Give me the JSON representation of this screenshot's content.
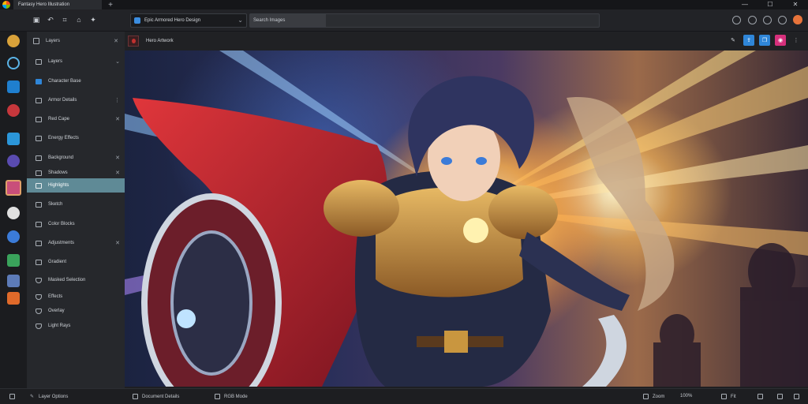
{
  "window": {
    "tab_title": "Fantasy Hero Illustration",
    "new_tab": "+",
    "minimize": "—",
    "maximize": "☐",
    "close": "✕"
  },
  "toolbar": {
    "address_value": "Epic Armored Hero Design",
    "search_label": "Search Images",
    "search_placeholder": ""
  },
  "sidebar": {
    "header": "Layers",
    "items": [
      {
        "label": "Layers"
      },
      {
        "label": "Character Base"
      },
      {
        "label": "Armor Details"
      },
      {
        "label": "Red Cape"
      },
      {
        "label": "Energy Effects"
      },
      {
        "label": "Background"
      },
      {
        "label": "Shadows"
      },
      {
        "label": "Highlights"
      },
      {
        "label": "Sketch"
      },
      {
        "label": "Color Blocks"
      },
      {
        "label": "Adjustments"
      },
      {
        "label": "Gradient"
      },
      {
        "label": "Masked Selection"
      },
      {
        "label": "Effects"
      },
      {
        "label": "Overlay"
      },
      {
        "label": "Light Rays"
      }
    ]
  },
  "doc_tab": {
    "label": "Hero Artwork"
  },
  "status": {
    "left_label": "Layer Options",
    "canvas_size": "Document Details",
    "color_mode": "RGB Mode",
    "zoom": "Zoom",
    "view": "100%",
    "fit": "Fit"
  },
  "colors": {
    "accent": "#5f8a96",
    "share_button": "#2f86d8",
    "export_button": "#d6307c",
    "avatar": "#e8743b"
  }
}
